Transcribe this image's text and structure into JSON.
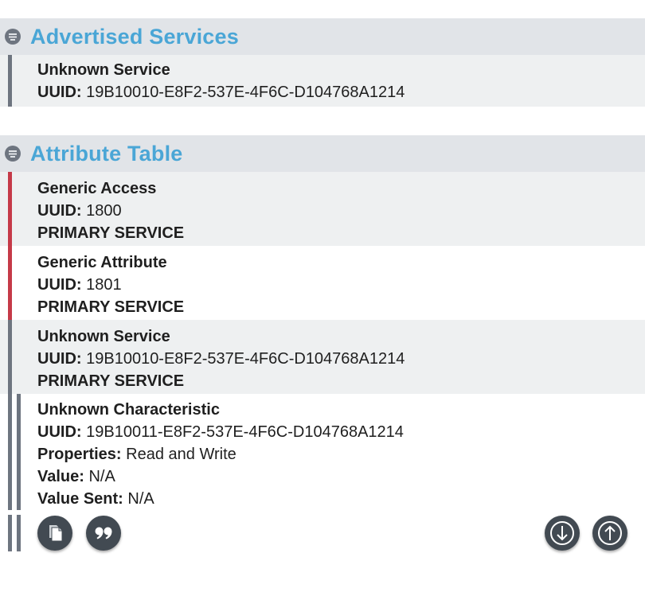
{
  "advertised": {
    "title": "Advertised Services",
    "service": {
      "name": "Unknown Service",
      "uuid_label": "UUID:",
      "uuid": "19B10010-E8F2-537E-4F6C-D104768A1214"
    }
  },
  "attribute_table": {
    "title": "Attribute Table",
    "entries": [
      {
        "name": "Generic Access",
        "uuid_label": "UUID:",
        "uuid": "1800",
        "type": "PRIMARY SERVICE"
      },
      {
        "name": "Generic Attribute",
        "uuid_label": "UUID:",
        "uuid": "1801",
        "type": "PRIMARY SERVICE"
      },
      {
        "name": "Unknown Service",
        "uuid_label": "UUID:",
        "uuid": "19B10010-E8F2-537E-4F6C-D104768A1214",
        "type": "PRIMARY SERVICE"
      }
    ],
    "characteristic": {
      "name": "Unknown Characteristic",
      "uuid_label": "UUID:",
      "uuid": "19B10011-E8F2-537E-4F6C-D104768A1214",
      "properties_label": "Properties:",
      "properties": "Read and Write",
      "value_label": "Value:",
      "value": "N/A",
      "value_sent_label": "Value Sent:",
      "value_sent": "N/A"
    }
  },
  "actions": {
    "copy_icon": "copy-icon",
    "quote_icon": "quote-icon",
    "down_icon": "arrow-down-icon",
    "up_icon": "arrow-up-icon"
  },
  "colors": {
    "title": "#4aa6d6",
    "header_bg": "#e1e4e8",
    "row_bg": "#eef0f1",
    "bar_gray": "#6e7580",
    "bar_red": "#c53a48",
    "button_bg": "#424a52"
  }
}
